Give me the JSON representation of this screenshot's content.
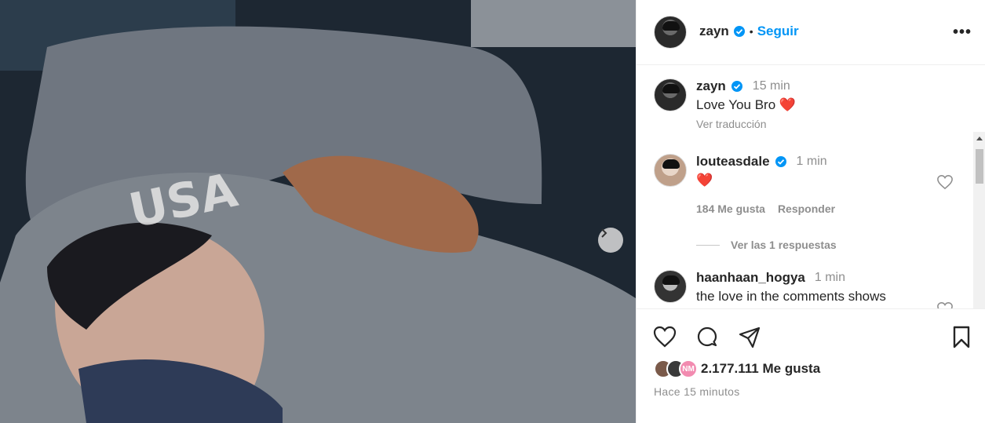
{
  "post": {
    "author": "zayn",
    "follow_label": "Seguir",
    "separator": "•",
    "more_label": "•••"
  },
  "caption": {
    "username": "zayn",
    "time": "15 min",
    "text": "Love You Bro",
    "emoji": "❤️",
    "translate_label": "Ver traducción"
  },
  "comments": [
    {
      "username": "louteasdale",
      "time": "1 min",
      "text": "❤️",
      "likes_label": "184 Me gusta",
      "reply_label": "Responder"
    },
    {
      "username": "haanhaan_hogya",
      "time": "1 min",
      "text": "the love in the comments shows"
    }
  ],
  "replies_label": "Ver las 1 respuestas",
  "likes_count": "2.177.111 Me gusta",
  "posted_time": "Hace 15 minutos",
  "liked_by_initials": "NM",
  "colors": {
    "accent": "#0095f6",
    "verified": "#0095f6",
    "heart": "#ed1c24",
    "muted": "#8e8e8e"
  },
  "icons": [
    "chevron-right-icon",
    "verified-icon",
    "more-icon",
    "heart-icon",
    "comment-icon",
    "share-icon",
    "bookmark-icon"
  ]
}
